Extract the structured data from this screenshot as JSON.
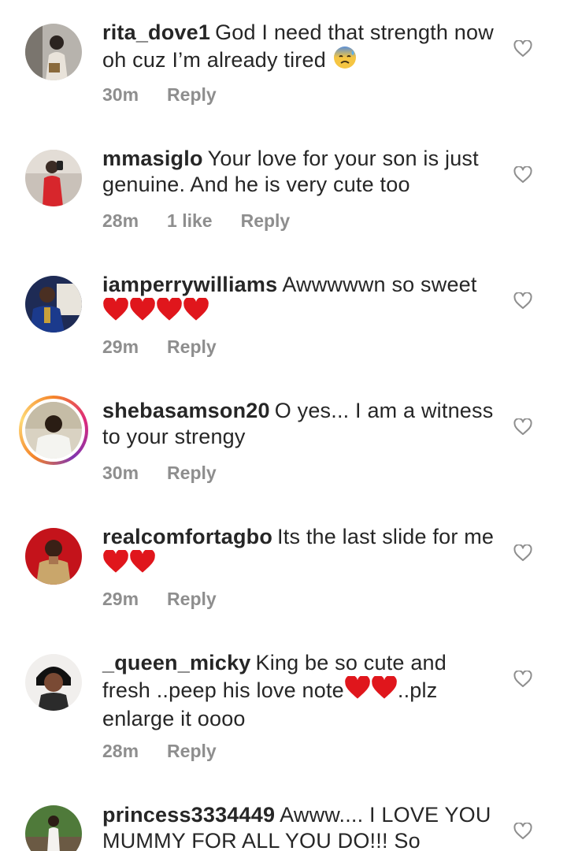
{
  "comments": [
    {
      "username": "rita_dove1",
      "text": "God I need that strength now oh cuz I’m already tired",
      "time": "30m",
      "likes": "",
      "reply": "Reply",
      "emoji": "anxious-sweat-face"
    },
    {
      "username": "mmasiglo",
      "text": "Your love for your son is just genuine. And he is very cute too",
      "time": "28m",
      "likes": "1 like",
      "reply": "Reply"
    },
    {
      "username": "iamperrywilliams",
      "text": "Awwwwwn so sweet",
      "time": "29m",
      "likes": "",
      "reply": "Reply",
      "emoji": "red-heart x4"
    },
    {
      "username": "shebasamson20",
      "text": "O yes... I am a witness to your strengy",
      "time": "30m",
      "likes": "",
      "reply": "Reply",
      "story_ring": true
    },
    {
      "username": "realcomfortagbo",
      "text": "Its the last slide for me",
      "time": "29m",
      "likes": "",
      "reply": "Reply",
      "emoji": "red-heart x2"
    },
    {
      "username": "_queen_micky",
      "text_part1": "King be so cute and fresh ..peep his love note",
      "text_part2": "..plz enlarge it oooo",
      "time": "28m",
      "likes": "",
      "reply": "Reply",
      "emoji": "red-heart x2"
    },
    {
      "username": "princess3334449",
      "text": "Awww.... I LOVE YOU MUMMY FOR ALL YOU DO!!! So"
    }
  ],
  "colors": {
    "text": "#262626",
    "meta": "#8e8e8e",
    "heart_red": "#e0161c"
  }
}
